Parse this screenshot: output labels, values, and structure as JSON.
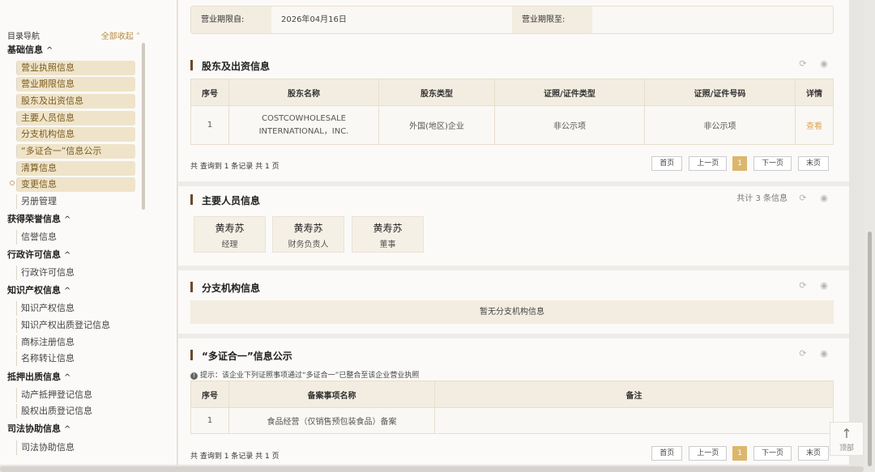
{
  "nav": {
    "title": "目录导航",
    "collapse_all": "全部收起 ˄",
    "groups": [
      {
        "label": "基础信息",
        "chev": "^"
      },
      {
        "label": "获得荣誉信息",
        "chev": "^"
      },
      {
        "label": "行政许可信息",
        "chev": "^"
      },
      {
        "label": "知识产权信息",
        "chev": "^"
      },
      {
        "label": "抵押出质信息",
        "chev": "^"
      },
      {
        "label": "司法协助信息",
        "chev": "^"
      }
    ],
    "items": [
      "营业执照信息",
      "营业期限信息",
      "股东及出资信息",
      "主要人员信息",
      "分支机构信息",
      "“多证合一”信息公示",
      "清算信息",
      "变更信息",
      "另册管理",
      "信誉信息",
      "行政许可信息",
      "知识产权信息",
      "知识产权出质登记信息",
      "商标注册信息",
      "名称转让信息",
      "动产抵押登记信息",
      "股权出质登记信息",
      "司法协助信息"
    ]
  },
  "term": {
    "from_label": "营业期限自:",
    "from_value": "2026年04月16日",
    "to_label": "营业期限至:",
    "to_value": ""
  },
  "shareholders": {
    "title": "股东及出资信息",
    "headers": [
      "序号",
      "股东名称",
      "股东类型",
      "证照/证件类型",
      "证照/证件号码",
      "详情"
    ],
    "rows": [
      [
        "1",
        "COSTCOWHOLESALE INTERNATIONAL，INC.",
        "外国(地区)企业",
        "非公示项",
        "非公示项",
        "查看"
      ]
    ],
    "summary": "共 查询到 1 条记录 共 1 页"
  },
  "pager": {
    "first": "首页",
    "prev": "上一页",
    "page": "1",
    "next": "下一页",
    "last": "末页"
  },
  "personnel": {
    "title": "主要人员信息",
    "count_text": "共计 3 条信息",
    "people": [
      {
        "name": "黄寿苏",
        "role": "经理"
      },
      {
        "name": "黄寿苏",
        "role": "财务负责人"
      },
      {
        "name": "黄寿苏",
        "role": "董事"
      }
    ]
  },
  "branches": {
    "title": "分支机构信息",
    "empty": "暂无分支机构信息"
  },
  "multi_cert": {
    "title": "“多证合一”信息公示",
    "hint": "提示：该企业下列证照事项通过“多证合一”已整合至该企业营业执照",
    "headers": [
      "序号",
      "备案事项名称",
      "备注"
    ],
    "rows": [
      [
        "1",
        "食品经营（仅销售预包装食品）备案",
        ""
      ]
    ],
    "summary": "共 查询到 1 条记录 共 1 页"
  },
  "top_button": {
    "label": "顶部"
  },
  "icons": {
    "refresh": "refresh-icon",
    "eye": "eye-icon",
    "info": "info-icon",
    "arrow_up": "arrow-up-icon"
  },
  "colors": {
    "accent": "#b8893e",
    "section_bar": "#6b4a2b",
    "active_nav": "#efe4c9",
    "current_page": "#dcb66b"
  }
}
